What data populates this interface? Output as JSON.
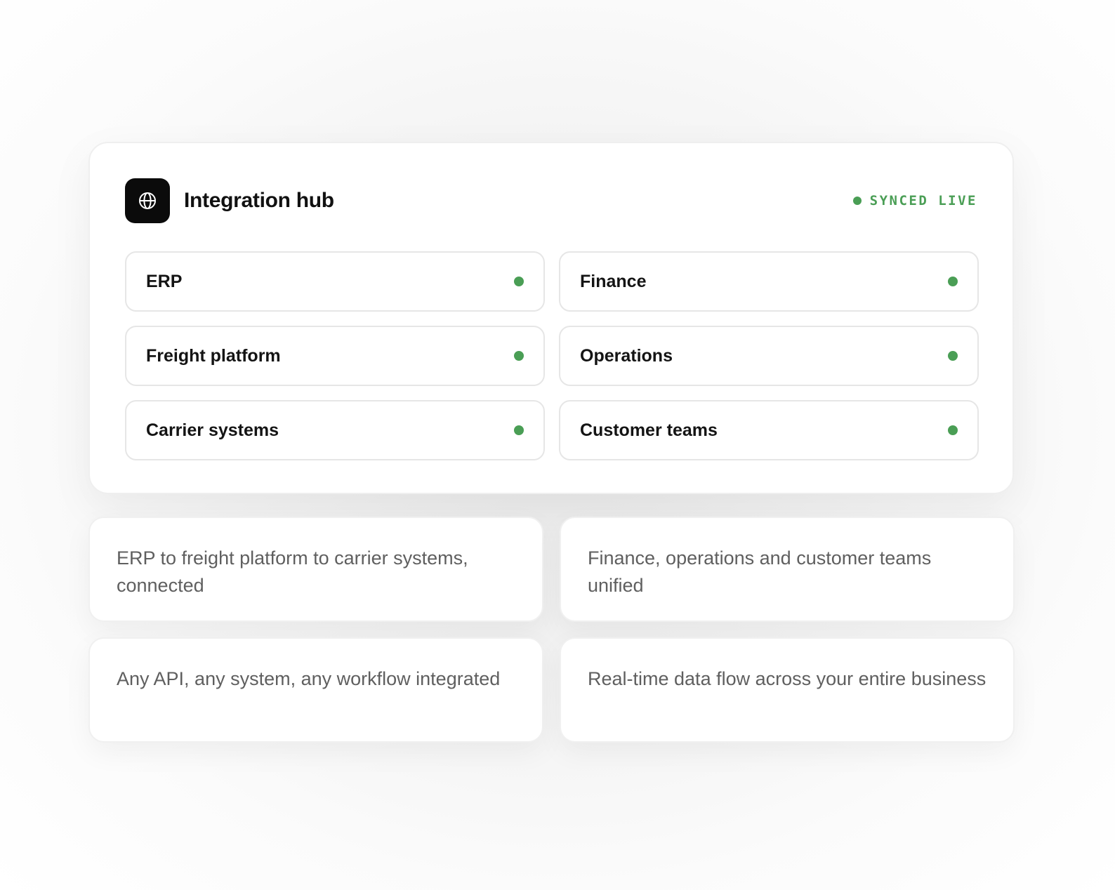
{
  "hub": {
    "title": "Integration hub",
    "icon": "globe-icon",
    "status": {
      "label": "SYNCED LIVE",
      "color": "#4a9e55"
    },
    "systems": [
      {
        "label": "ERP",
        "status": "connected"
      },
      {
        "label": "Finance",
        "status": "connected"
      },
      {
        "label": "Freight platform",
        "status": "connected"
      },
      {
        "label": "Operations",
        "status": "connected"
      },
      {
        "label": "Carrier systems",
        "status": "connected"
      },
      {
        "label": "Customer teams",
        "status": "connected"
      }
    ]
  },
  "features": [
    {
      "text": "ERP to freight platform to carrier systems, connected"
    },
    {
      "text": "Finance, operations and customer teams unified"
    },
    {
      "text": "Any API, any system, any workflow integrated"
    },
    {
      "text": "Real-time data flow across your entire business"
    }
  ],
  "colors": {
    "accent_green": "#4a9e55",
    "icon_background": "#0b0b0b",
    "feature_text": "#5f5f5f"
  }
}
